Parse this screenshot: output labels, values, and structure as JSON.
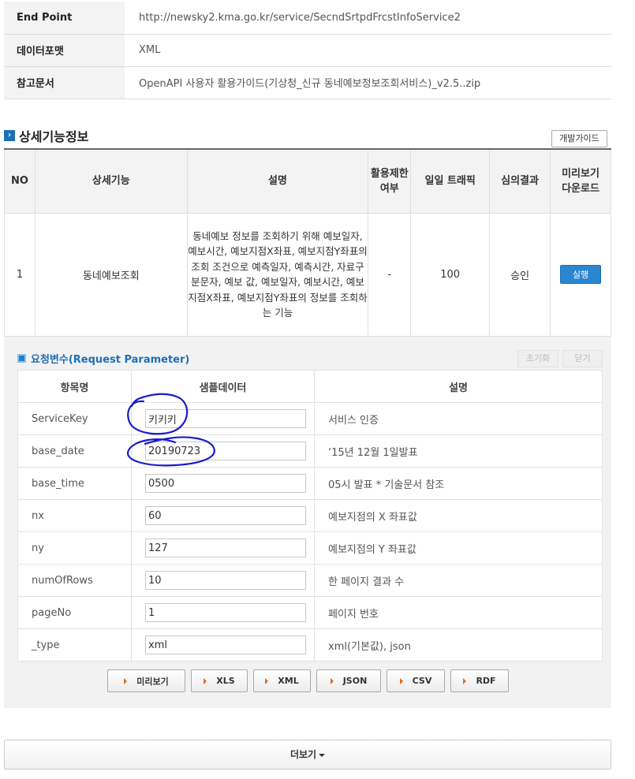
{
  "service_info": [
    {
      "label": "End Point",
      "value": "http://newsky2.kma.go.kr/service/SecndSrtpdFrcstInfoService2"
    },
    {
      "label": "데이터포맷",
      "value": "XML"
    },
    {
      "label": "참고문서",
      "value": "OpenAPI 사용자 활용가이드(기상청_신규 동네예보정보조회서비스)_v2.5..zip"
    }
  ],
  "detail_section": {
    "title": "상세기능정보",
    "guide_button": "개발가이드",
    "headers": [
      "NO",
      "상세기능",
      "설명",
      "활용제한 여부",
      "일일 트래픽",
      "심의결과",
      "미리보기 다운로드"
    ],
    "row": {
      "no": "1",
      "function": "동네예보조회",
      "description": "동네예보 정보를 조회하기 위해 예보일자, 예보시간, 예보지점X좌표, 예보지점Y좌표의 조회 조건으로 예측일자, 예측시간, 자료구분문자, 예보 값, 예보일자, 예보시간, 예보지점X좌표, 예보지점Y좌표의 정보를 조회하는 기능",
      "limit": "-",
      "traffic": "100",
      "review": "승인",
      "run_button": "실행"
    }
  },
  "request_params": {
    "title": "요청변수(Request Parameter)",
    "reset_button": "초기화",
    "close_button": "닫기",
    "headers": [
      "항목명",
      "샘플데이터",
      "설명"
    ],
    "rows": [
      {
        "name": "ServiceKey",
        "value": "키키키",
        "desc": "서비스 인증"
      },
      {
        "name": "base_date",
        "value": "20190723",
        "desc": "‘15년 12월 1일발표"
      },
      {
        "name": "base_time",
        "value": "0500",
        "desc": "05시 발표 * 기술문서 참조"
      },
      {
        "name": "nx",
        "value": "60",
        "desc": "예보지점의 X 좌표값"
      },
      {
        "name": "ny",
        "value": "127",
        "desc": "예보지점의 Y 좌표값"
      },
      {
        "name": "numOfRows",
        "value": "10",
        "desc": "한 페이지 결과 수"
      },
      {
        "name": "pageNo",
        "value": "1",
        "desc": "페이지 번호"
      },
      {
        "name": "_type",
        "value": "xml",
        "desc": "xml(기본값), json"
      }
    ],
    "format_buttons": [
      "미리보기",
      "XLS",
      "XML",
      "JSON",
      "CSV",
      "RDF"
    ]
  },
  "more_button": "더보기",
  "colors": {
    "accent": "#1f6fb6",
    "run_button": "#2a86d1",
    "annotation_ink": "#1a1acc",
    "format_arrow": "#e06b1c"
  }
}
